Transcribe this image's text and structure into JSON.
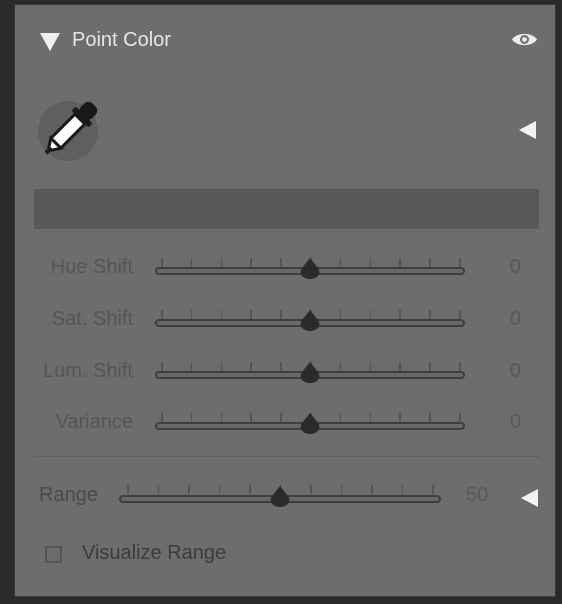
{
  "panel": {
    "title": "Point Color",
    "collapse_icon": "triangle-down-icon",
    "visibility_icon": "eye-icon",
    "eyedropper_icon": "eyedropper-icon",
    "expand_icon": "triangle-left-icon"
  },
  "sliders": [
    {
      "label": "Hue Shift",
      "value": "0",
      "fraction": 0.5
    },
    {
      "label": "Sat. Shift",
      "value": "0",
      "fraction": 0.5
    },
    {
      "label": "Lum. Shift",
      "value": "0",
      "fraction": 0.5
    },
    {
      "label": "Variance",
      "value": "0",
      "fraction": 0.5
    }
  ],
  "range": {
    "label": "Range",
    "value": "50",
    "fraction": 0.5,
    "expand_icon": "triangle-left-icon"
  },
  "visualize": {
    "label": "Visualize Range",
    "checked": false
  },
  "colors": {
    "panel_bg": "#6d6d6d",
    "swatch": "#595959",
    "label_text": "#555555",
    "title_text": "#e6e6e6"
  }
}
